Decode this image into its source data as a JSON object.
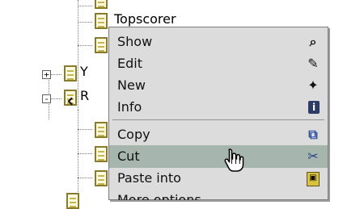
{
  "tree": {
    "items": [
      {
        "label": "Topscorer"
      },
      {
        "label": "Y"
      },
      {
        "label": "R"
      },
      {
        "label": ""
      }
    ]
  },
  "context_menu": {
    "items": [
      {
        "label": "Show",
        "icon": "search-icon"
      },
      {
        "label": "Edit",
        "icon": "edit-icon"
      },
      {
        "label": "New",
        "icon": "new-icon"
      },
      {
        "label": "Info",
        "icon": "info-icon"
      },
      {
        "label": "Copy",
        "icon": "copy-icon"
      },
      {
        "label": "Cut",
        "icon": "scissors-icon",
        "highlighted": true
      },
      {
        "label": "Paste into",
        "icon": "paste-icon"
      },
      {
        "label": "More options",
        "icon": ""
      }
    ]
  },
  "colors": {
    "menu_bg": "#dcdcdc",
    "menu_hover": "#a6b6ae",
    "menu_border": "#7c7c7c",
    "tree_line": "#7a7a7a"
  }
}
